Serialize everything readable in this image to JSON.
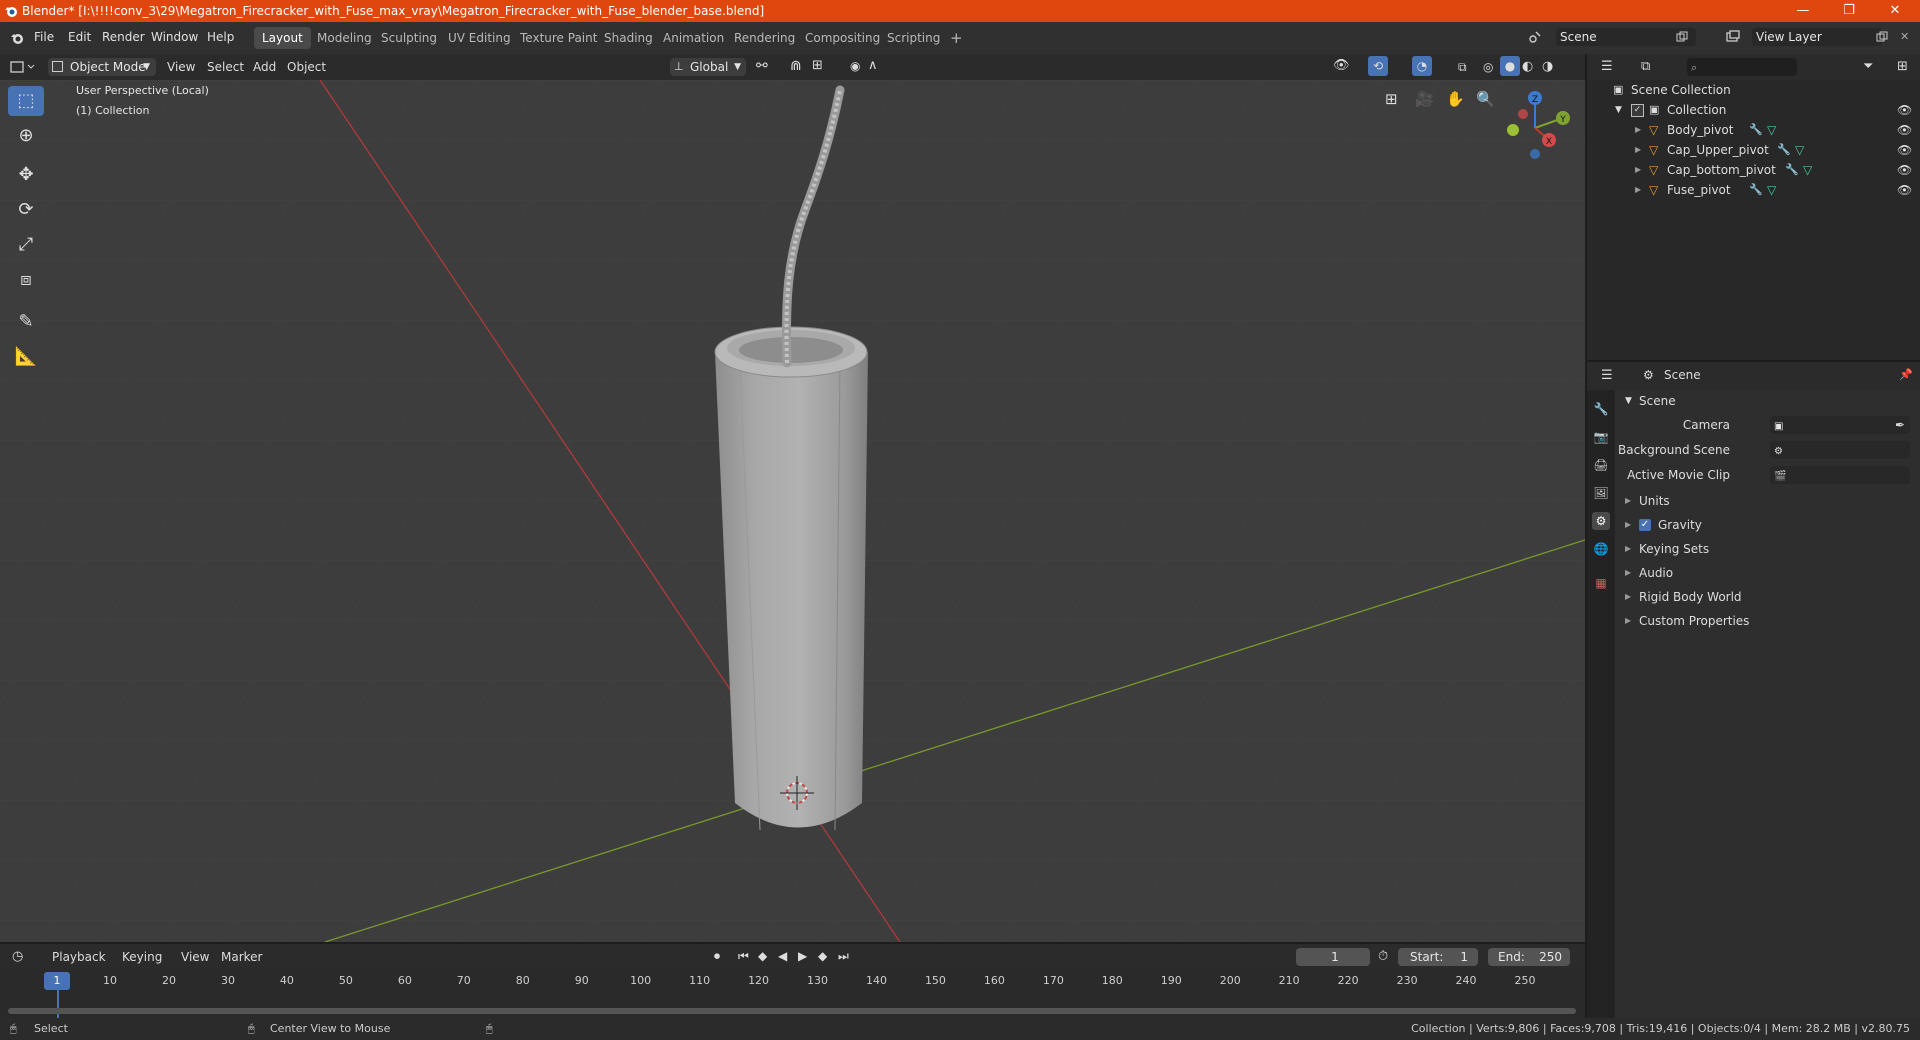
{
  "window": {
    "title": "Blender* [I:\\!!!!conv_3\\29\\Megatron_Firecracker_with_Fuse_max_vray\\Megatron_Firecracker_with_Fuse_blender_base.blend]",
    "minimize": "—",
    "restore": "❐",
    "close": "✕"
  },
  "menu": [
    "File",
    "Edit",
    "Render",
    "Window",
    "Help"
  ],
  "workspaces": [
    "Layout",
    "Modeling",
    "Sculpting",
    "UV Editing",
    "Texture Paint",
    "Shading",
    "Animation",
    "Rendering",
    "Compositing",
    "Scripting"
  ],
  "active_workspace": "Layout",
  "add_workspace": "+",
  "scene_field": "Scene",
  "view_layer_field": "View Layer",
  "viewport_header": {
    "mode": "Object Mode",
    "menus": [
      "View",
      "Select",
      "Add",
      "Object"
    ],
    "transform": "Global"
  },
  "viewport": {
    "perspective": "User Perspective (Local)",
    "collection": "(1) Collection",
    "gizmo": {
      "z": "Z",
      "y": "Y",
      "x": "X"
    }
  },
  "outliner": {
    "root": "Scene Collection",
    "collection": "Collection",
    "items": [
      "Body_pivot",
      "Cap_Upper_pivot",
      "Cap_bottom_pivot",
      "Fuse_pivot"
    ],
    "search_placeholder": ""
  },
  "properties": {
    "header": "Scene",
    "panel": "Scene",
    "camera_label": "Camera",
    "background_label": "Background Scene",
    "movie_clip_label": "Active Movie Clip",
    "sections": [
      "Units",
      "Gravity",
      "Keying Sets",
      "Audio",
      "Rigid Body World",
      "Custom Properties"
    ]
  },
  "timeline": {
    "menus": [
      "Playback",
      "Keying",
      "View",
      "Marker"
    ],
    "current_frame": "1",
    "start_label": "Start:",
    "start": "1",
    "end_label": "End:",
    "end": "250",
    "ticks": [
      "1",
      "10",
      "20",
      "30",
      "40",
      "50",
      "60",
      "70",
      "80",
      "90",
      "100",
      "110",
      "120",
      "130",
      "140",
      "150",
      "160",
      "170",
      "180",
      "190",
      "200",
      "210",
      "220",
      "230",
      "240",
      "250"
    ]
  },
  "status": {
    "select": "Select",
    "center": "Center View to Mouse",
    "stats": "Collection | Verts:9,806 | Faces:9,708 | Tris:19,416 | Objects:0/4 | Mem: 28.2 MB | v2.80.75"
  },
  "colors": {
    "titlebar": "#e0470e",
    "accent": "#4772b3",
    "viewport_bg": "#3d3d3d",
    "x_axis": "#c0392b",
    "y_axis": "#7fa332"
  }
}
